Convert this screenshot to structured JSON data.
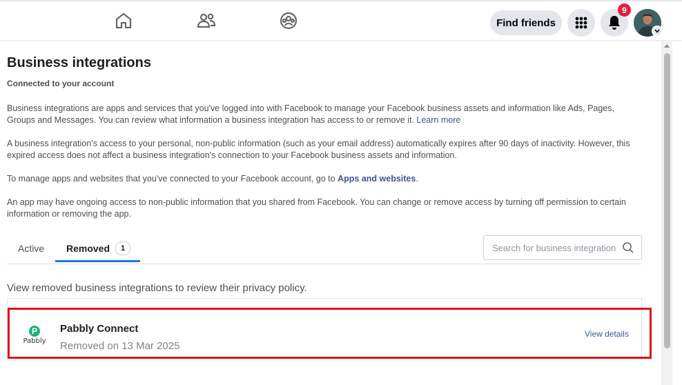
{
  "topbar": {
    "nav_icons": [
      "home-icon",
      "friends-icon",
      "groups-icon"
    ],
    "find_friends_label": "Find friends",
    "menu_icon": "grid-menu-icon",
    "notifications_icon": "bell-icon",
    "notifications_count": "9",
    "account_icon": "avatar"
  },
  "page": {
    "title": "Business integrations",
    "subtitle": "Connected to your account",
    "para1_text": "Business integrations are apps and services that you've logged into with Facebook to manage your Facebook business assets and information like Ads, Pages, Groups and Messages. You can review what information a business integration has access to or remove it.",
    "para1_link": "Learn more",
    "para2_text": "A business integration's access to your personal, non-public information (such as your email address) automatically expires after 90 days of inactivity. However, this expired access does not affect a business integration's connection to your Facebook business assets and information.",
    "para3_text": "To manage apps and websites that you've connected to your Facebook account, go to",
    "para3_link": "Apps and websites",
    "para3_end": ".",
    "para4_text": "An app may have ongoing access to non-public information that you shared from Facebook. You can change or remove access by turning off permission to certain information or removing the app."
  },
  "tabs": {
    "active_label": "Active",
    "removed_label": "Removed",
    "removed_count": "1",
    "selected": "Removed"
  },
  "search": {
    "placeholder": "Search for business integrations",
    "value": ""
  },
  "removed": {
    "note": "View removed business integrations to review their privacy policy.",
    "items": [
      {
        "logo_letter": "P",
        "logo_word": "Pabbly",
        "name": "Pabbly Connect",
        "status": "Removed on 13 Mar 2025",
        "action": "View details"
      }
    ]
  },
  "colors": {
    "accent": "#1877f2",
    "link": "#385898",
    "badge": "#e41e3f",
    "highlight": "#e0101a",
    "pabbly_green": "#20b276"
  }
}
